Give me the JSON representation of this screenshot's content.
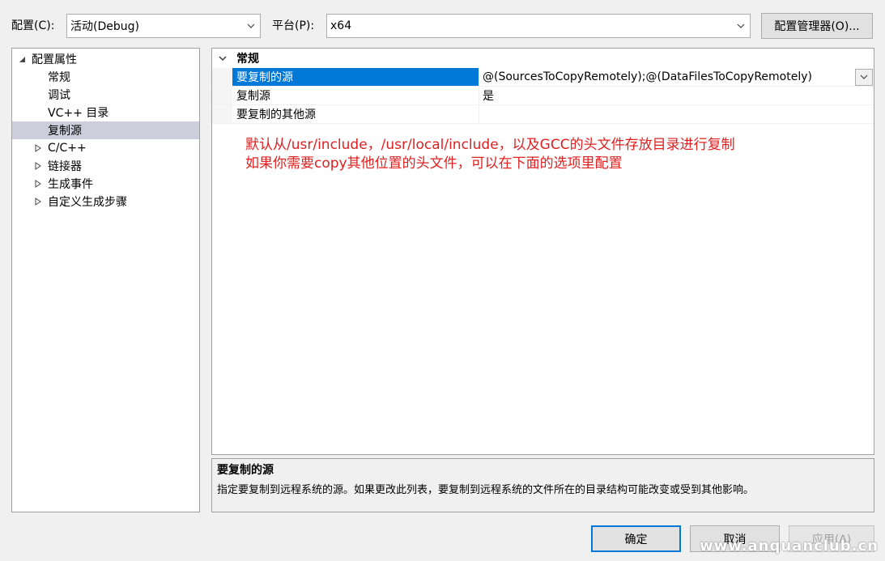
{
  "header": {
    "config_label": "配置(C):",
    "config_value": "活动(Debug)",
    "platform_label": "平台(P):",
    "platform_value": "x64",
    "config_manager_button": "配置管理器(O)..."
  },
  "tree": {
    "root": "配置属性",
    "items": [
      {
        "label": "常规"
      },
      {
        "label": "调试"
      },
      {
        "label": "VC++ 目录"
      },
      {
        "label": "复制源"
      },
      {
        "label": "C/C++"
      },
      {
        "label": "链接器"
      },
      {
        "label": "生成事件"
      },
      {
        "label": "自定义生成步骤"
      }
    ]
  },
  "grid": {
    "category": "常规",
    "rows": [
      {
        "name": "要复制的源",
        "value": "@(SourcesToCopyRemotely);@(DataFilesToCopyRemotely)"
      },
      {
        "name": "复制源",
        "value": "是"
      },
      {
        "name": "要复制的其他源",
        "value": ""
      }
    ]
  },
  "annotation": {
    "line1": "默认从/usr/include，/usr/local/include，以及GCC的头文件存放目录进行复制",
    "line2": "如果你需要copy其他位置的头文件，可以在下面的选项里配置"
  },
  "description": {
    "title": "要复制的源",
    "text": "指定要复制到远程系统的源。如果更改此列表，要复制到远程系统的文件所在的目录结构可能改变或受到其他影响。"
  },
  "footer": {
    "ok": "确定",
    "cancel": "取消",
    "apply": "应用(A)"
  },
  "watermark": "www.anquanclub.cn",
  "colors": {
    "selection": "#0078d7",
    "tree_selection": "#cccedb",
    "annotation": "#e02020"
  }
}
